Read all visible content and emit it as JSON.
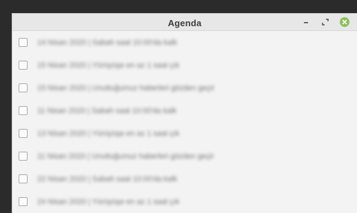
{
  "window": {
    "title": "Agenda"
  },
  "controls": {
    "minimize_icon": "minimize-icon",
    "restore_icon": "restore-icon",
    "close_icon": "close-icon",
    "close_color": "#8bbf5c"
  },
  "items": [
    {
      "checked": false,
      "text": "14 Nisan 2020 | Sabah saat 10:00'da kalk"
    },
    {
      "checked": false,
      "text": "15 Nisan 2020 | Yürüyüşe en az 1 saat çık"
    },
    {
      "checked": false,
      "text": "15 Nisan 2020 | Unuttuğumuz haberleri gözden geçir"
    },
    {
      "checked": false,
      "text": "11 Nisan 2020 | Sabah saat 10:00'da kalk"
    },
    {
      "checked": false,
      "text": "13 Nisan 2020 | Yürüyüşe en az 1 saat çık"
    },
    {
      "checked": false,
      "text": "11 Nisan 2020 | Unuttuğumuz haberleri gözden geçir"
    },
    {
      "checked": false,
      "text": "22 Nisan 2020 | Sabah saat 10:00'da kalk"
    },
    {
      "checked": false,
      "text": "24 Nisan 2020 | Yürüyüşe en az 1 saat çık"
    }
  ]
}
